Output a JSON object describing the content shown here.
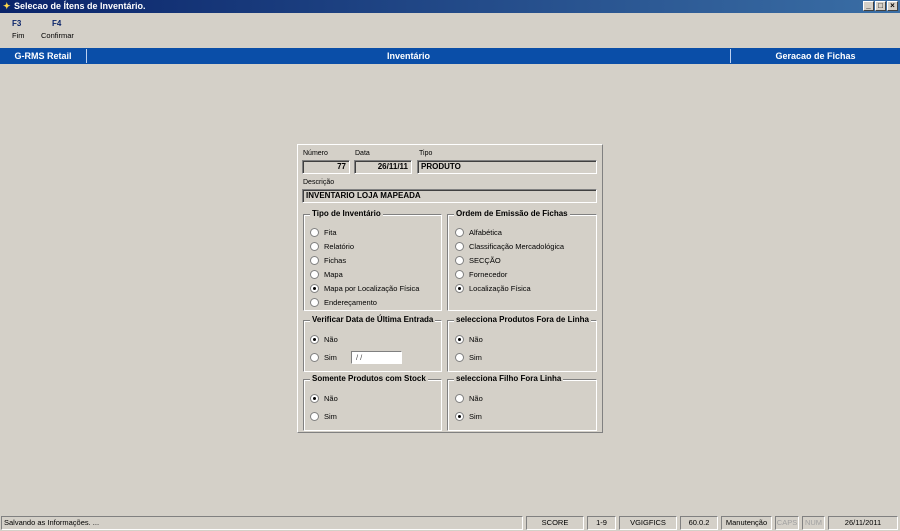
{
  "window": {
    "title": "Selecao de Ítens de Inventário."
  },
  "toolbar": {
    "buttons": [
      {
        "key": "F3",
        "label": "Fim"
      },
      {
        "key": "F4",
        "label": "Confirmar"
      }
    ]
  },
  "header": {
    "left": "G-RMS Retail",
    "center": "Inventário",
    "right": "Geracao de Fichas"
  },
  "form": {
    "numero": {
      "label": "Número",
      "value": "77"
    },
    "data": {
      "label": "Data",
      "value": "26/11/11"
    },
    "tipo": {
      "label": "Tipo",
      "value": "PRODUTO"
    },
    "descricao": {
      "label": "Descrição",
      "value": "INVENTARIO LOJA MAPEADA"
    },
    "tipo_inventario": {
      "title": "Tipo de Inventário",
      "options": [
        "Fita",
        "Relatório",
        "Fichas",
        "Mapa",
        "Mapa por Localização Física",
        "Endereçamento"
      ],
      "selected": "Mapa por Localização Física"
    },
    "ordem_emissao": {
      "title": "Ordem de Emissão de Fichas",
      "options": [
        "Alfabética",
        "Classificação Mercadológica",
        "SECÇÃO",
        "Fornecedor",
        "Localização Física"
      ],
      "selected": "Localização Física"
    },
    "verificar_data": {
      "title": "Verificar Data de Última Entrada",
      "options": [
        "Não",
        "Sim"
      ],
      "selected": "Não",
      "date_value": " / /"
    },
    "produtos_fora_linha": {
      "title": "selecciona Produtos Fora de Linha",
      "options": [
        "Não",
        "Sim"
      ],
      "selected": "Não"
    },
    "somente_stock": {
      "title": "Somente Produtos com Stock",
      "options": [
        "Não",
        "Sim"
      ],
      "selected": "Não"
    },
    "filho_fora_linha": {
      "title": "selecciona Filho Fora Linha",
      "options": [
        "Não",
        "Sim"
      ],
      "selected": "Sim"
    }
  },
  "statusbar": {
    "message": "Salvando as Informações. ...",
    "score": "SCORE",
    "range": "1-9",
    "program": "VGIGFICS",
    "version": "60.0.2",
    "mode": "Manutenção",
    "caps": "CAPS",
    "num": "NUM",
    "date": "26/11/2011"
  }
}
